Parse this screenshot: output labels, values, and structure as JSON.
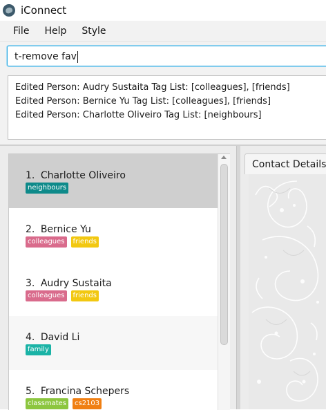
{
  "window": {
    "title": "iConnect"
  },
  "menu": {
    "file": "File",
    "help": "Help",
    "style": "Style"
  },
  "command": {
    "value": "t-remove fav"
  },
  "result": {
    "lines": [
      "Edited Person: Audry Sustaita Tag List: [colleagues], [friends]",
      "Edited Person: Bernice Yu Tag List: [colleagues], [friends]",
      "Edited Person: Charlotte Oliveiro Tag List: [neighbours]"
    ]
  },
  "persons": [
    {
      "index": "1.",
      "name": "Charlotte Oliveiro",
      "tags": [
        {
          "label": "neighbours",
          "color": "#0e8a8a"
        }
      ]
    },
    {
      "index": "2.",
      "name": "Bernice Yu",
      "tags": [
        {
          "label": "colleagues",
          "color": "#d96b8c"
        },
        {
          "label": "friends",
          "color": "#f2c811"
        }
      ]
    },
    {
      "index": "3.",
      "name": "Audry Sustaita",
      "tags": [
        {
          "label": "colleagues",
          "color": "#d96b8c"
        },
        {
          "label": "friends",
          "color": "#f2c811"
        }
      ]
    },
    {
      "index": "4.",
      "name": "David Li",
      "tags": [
        {
          "label": "family",
          "color": "#1ab3a6"
        }
      ]
    },
    {
      "index": "5.",
      "name": "Francina Schepers",
      "tags": [
        {
          "label": "classmates",
          "color": "#8cc63f"
        },
        {
          "label": "cs2103",
          "color": "#f07f13"
        }
      ]
    }
  ],
  "details": {
    "tab_label": "Contact Details"
  },
  "icons": {
    "app": "app-logo-icon",
    "scroll_up": "chevron-up-icon"
  }
}
